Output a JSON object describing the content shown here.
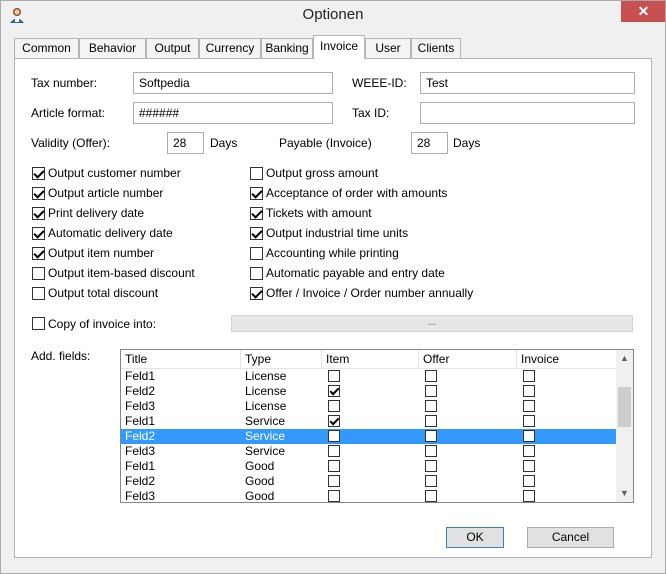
{
  "window": {
    "title": "Optionen",
    "close_glyph": "✕"
  },
  "tabs": [
    "Common",
    "Behavior",
    "Output",
    "Currency",
    "Banking",
    "Invoice",
    "User",
    "Clients"
  ],
  "active_tab": "Invoice",
  "fields": {
    "tax_number": {
      "label": "Tax number:",
      "value": "Softpedia"
    },
    "weee_id": {
      "label": "WEEE-ID:",
      "value": "Test"
    },
    "article_format": {
      "label": "Article format:",
      "value": "######"
    },
    "tax_id": {
      "label": "Tax ID:",
      "value": ""
    },
    "validity": {
      "label": "Validity (Offer):",
      "value": "28",
      "unit": "Days"
    },
    "payable": {
      "label": "Payable (Invoice)",
      "value": "28",
      "unit": "Days"
    }
  },
  "options_left": [
    {
      "label": "Output customer number",
      "checked": true
    },
    {
      "label": "Output article number",
      "checked": true
    },
    {
      "label": "Print delivery date",
      "checked": true
    },
    {
      "label": "Automatic delivery date",
      "checked": true
    },
    {
      "label": "Output item number",
      "checked": true
    },
    {
      "label": "Output item-based discount",
      "checked": false
    },
    {
      "label": "Output total discount",
      "checked": false
    }
  ],
  "options_right": [
    {
      "label": "Output gross amount",
      "checked": false
    },
    {
      "label": "Acceptance of order with amounts",
      "checked": true
    },
    {
      "label": "Tickets with amount",
      "checked": true
    },
    {
      "label": "Output industrial time units",
      "checked": true
    },
    {
      "label": "Accounting while printing",
      "checked": false
    },
    {
      "label": "Automatic payable and entry date",
      "checked": false
    },
    {
      "label": "Offer / Invoice / Order number annually",
      "checked": true
    }
  ],
  "copy_invoice": {
    "label": "Copy of invoice into:",
    "checked": false,
    "browse_label": "..."
  },
  "add_fields": {
    "label": "Add. fields:",
    "columns": [
      "Title",
      "Type",
      "Item",
      "Offer",
      "Invoice"
    ],
    "rows": [
      {
        "title": "Feld1",
        "type": "License",
        "item": false,
        "offer": false,
        "invoice": false,
        "selected": false
      },
      {
        "title": "Feld2",
        "type": "License",
        "item": true,
        "offer": false,
        "invoice": false,
        "selected": false
      },
      {
        "title": "Feld3",
        "type": "License",
        "item": false,
        "offer": false,
        "invoice": false,
        "selected": false
      },
      {
        "title": "Feld1",
        "type": "Service",
        "item": true,
        "offer": false,
        "invoice": false,
        "selected": false
      },
      {
        "title": "Feld2",
        "type": "Service",
        "item": false,
        "offer": false,
        "invoice": false,
        "selected": true
      },
      {
        "title": "Feld3",
        "type": "Service",
        "item": false,
        "offer": false,
        "invoice": false,
        "selected": false
      },
      {
        "title": "Feld1",
        "type": "Good",
        "item": false,
        "offer": false,
        "invoice": false,
        "selected": false
      },
      {
        "title": "Feld2",
        "type": "Good",
        "item": false,
        "offer": false,
        "invoice": false,
        "selected": false
      },
      {
        "title": "Feld3",
        "type": "Good",
        "item": false,
        "offer": false,
        "invoice": false,
        "selected": false
      }
    ]
  },
  "buttons": {
    "ok": "OK",
    "cancel": "Cancel"
  },
  "scrollbar": {
    "up_glyph": "▲",
    "down_glyph": "▼"
  },
  "colors": {
    "selection": "#3399ff",
    "close": "#c75050"
  },
  "icons": {
    "app": "user-avatar-icon"
  }
}
